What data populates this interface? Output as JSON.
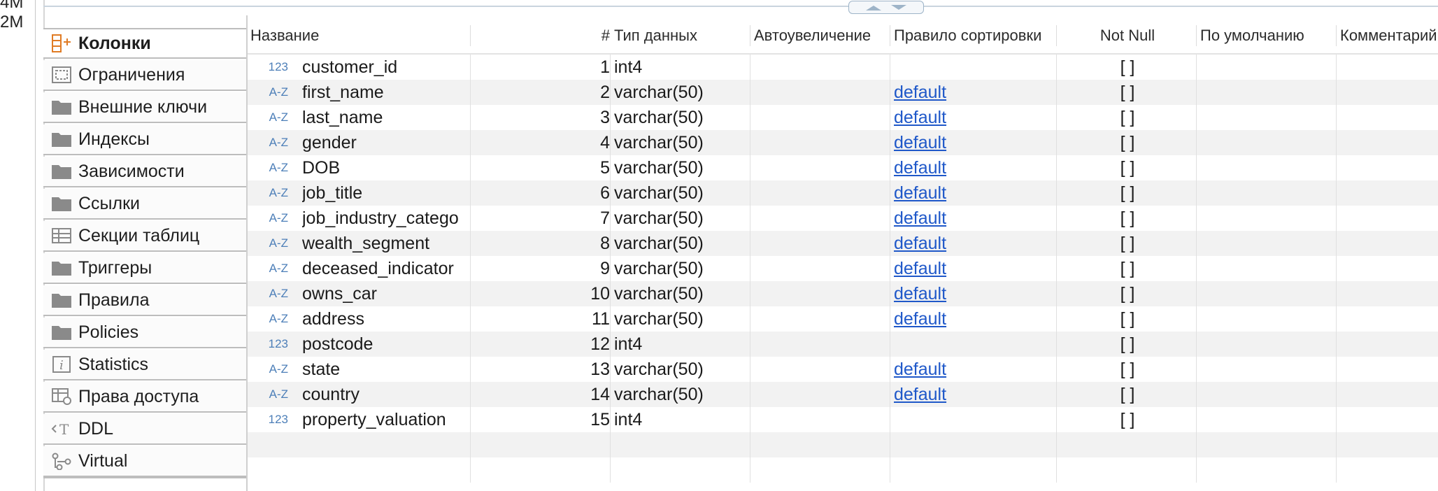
{
  "left_fragments": [
    "4M",
    "2M"
  ],
  "sidebar": {
    "items": [
      {
        "label": "Колонки",
        "icon": "columns-icon",
        "active": true
      },
      {
        "label": "Ограничения",
        "icon": "constraints-icon"
      },
      {
        "label": "Внешние ключи",
        "icon": "folder-icon"
      },
      {
        "label": "Индексы",
        "icon": "folder-icon"
      },
      {
        "label": "Зависимости",
        "icon": "folder-icon"
      },
      {
        "label": "Ссылки",
        "icon": "folder-icon"
      },
      {
        "label": "Секции таблиц",
        "icon": "table-partitions-icon"
      },
      {
        "label": "Триггеры",
        "icon": "folder-icon"
      },
      {
        "label": "Правила",
        "icon": "folder-icon"
      },
      {
        "label": "Policies",
        "icon": "folder-icon"
      },
      {
        "label": "Statistics",
        "icon": "info-icon"
      },
      {
        "label": "Права доступа",
        "icon": "permissions-icon"
      },
      {
        "label": "DDL",
        "icon": "ddl-icon"
      },
      {
        "label": "Virtual",
        "icon": "virtual-icon"
      }
    ]
  },
  "grid": {
    "headers": [
      "Название",
      "#",
      "Тип данных",
      "Автоувеличение",
      "Правило сортировки",
      "Not Null",
      "По умолчанию",
      "Комментарий"
    ],
    "rows": [
      {
        "type_icon": "123",
        "name": "customer_id",
        "num": "1",
        "dtype": "int4",
        "collation": "",
        "notnull": "[ ]"
      },
      {
        "type_icon": "A-Z",
        "name": "first_name",
        "num": "2",
        "dtype": "varchar(50)",
        "collation": "default",
        "notnull": "[ ]"
      },
      {
        "type_icon": "A-Z",
        "name": "last_name",
        "num": "3",
        "dtype": "varchar(50)",
        "collation": "default",
        "notnull": "[ ]"
      },
      {
        "type_icon": "A-Z",
        "name": "gender",
        "num": "4",
        "dtype": "varchar(50)",
        "collation": "default",
        "notnull": "[ ]"
      },
      {
        "type_icon": "A-Z",
        "name": "DOB",
        "num": "5",
        "dtype": "varchar(50)",
        "collation": "default",
        "notnull": "[ ]"
      },
      {
        "type_icon": "A-Z",
        "name": "job_title",
        "num": "6",
        "dtype": "varchar(50)",
        "collation": "default",
        "notnull": "[ ]"
      },
      {
        "type_icon": "A-Z",
        "name": "job_industry_catego",
        "num": "7",
        "dtype": "varchar(50)",
        "collation": "default",
        "notnull": "[ ]"
      },
      {
        "type_icon": "A-Z",
        "name": "wealth_segment",
        "num": "8",
        "dtype": "varchar(50)",
        "collation": "default",
        "notnull": "[ ]"
      },
      {
        "type_icon": "A-Z",
        "name": "deceased_indicator",
        "num": "9",
        "dtype": "varchar(50)",
        "collation": "default",
        "notnull": "[ ]"
      },
      {
        "type_icon": "A-Z",
        "name": "owns_car",
        "num": "10",
        "dtype": "varchar(50)",
        "collation": "default",
        "notnull": "[ ]"
      },
      {
        "type_icon": "A-Z",
        "name": "address",
        "num": "11",
        "dtype": "varchar(50)",
        "collation": "default",
        "notnull": "[ ]"
      },
      {
        "type_icon": "123",
        "name": "postcode",
        "num": "12",
        "dtype": "int4",
        "collation": "",
        "notnull": "[ ]"
      },
      {
        "type_icon": "A-Z",
        "name": "state",
        "num": "13",
        "dtype": "varchar(50)",
        "collation": "default",
        "notnull": "[ ]"
      },
      {
        "type_icon": "A-Z",
        "name": "country",
        "num": "14",
        "dtype": "varchar(50)",
        "collation": "default",
        "notnull": "[ ]"
      },
      {
        "type_icon": "123",
        "name": "property_valuation",
        "num": "15",
        "dtype": "int4",
        "collation": "",
        "notnull": "[ ]"
      }
    ]
  },
  "colors": {
    "link": "#1f58c9",
    "type_icon": "#4d7fb8",
    "row_alt": "#f2f2f2",
    "icon_gray": "#8a8a8a",
    "accent_orange": "#e07b24"
  }
}
